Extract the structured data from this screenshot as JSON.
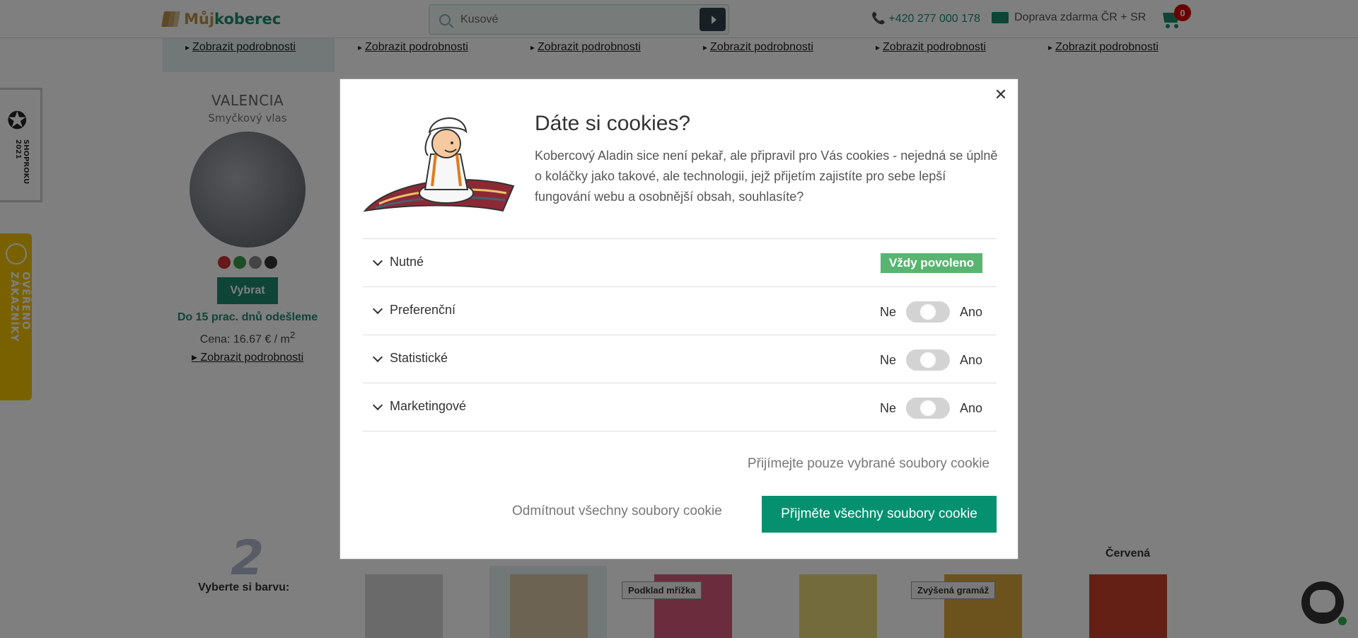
{
  "header": {
    "logo_part1": "Můj",
    "logo_part2": "koberec",
    "search_value": "Kusové",
    "phone": "+420 277 000 178",
    "shipping": "Doprava zdarma ČR + SR",
    "cart_count": "0"
  },
  "background": {
    "detail_links": [
      "Zobrazit podrobnosti",
      "Zobrazit podrobnosti",
      "Zobrazit podrobnosti",
      "Zobrazit podrobnosti",
      "Zobrazit podrobnosti",
      "Zobrazit podrobnosti"
    ],
    "product": {
      "name": "VALENCIA",
      "subtitle": "Smyčkový vlas",
      "color_dots": [
        "#cc3333",
        "#3a9a4a",
        "#888888",
        "#333333"
      ],
      "button": "Vybrat",
      "shipping": "Do 15 prac. dnů odešleme",
      "price": "Cena: 16.67 € / m",
      "price_sup": "2",
      "detail": "Zobrazit podrobnosti"
    },
    "badge_shoproku": "SHOPROKU 2021",
    "badge_overeno": "OVĚŘENO ZÁKAZNÍKY",
    "step_number": "2",
    "step_label": "Vyberte si barvu:",
    "swatch_tags": [
      "Podklad mřížka",
      "Zvýšená gramáž"
    ],
    "color_label": "Červená",
    "swatch_colors": [
      "#d4d4d4",
      "#d9c7a7",
      "#d65b7c",
      "#e8d77a",
      "#d9a73a",
      "#c8402a"
    ]
  },
  "modal": {
    "title": "Dáte si cookies?",
    "text": "Kobercový Aladin sice není pekař, ale připravil pro Vás cookies - nejedná se úplně o koláčky jako takové, ale technologii, jejž přijetím zajistíte pro sebe lepší fungování webu a osobnější obsah, souhlasíte?",
    "categories": [
      {
        "name": "Nutné",
        "always": "Vždy povoleno"
      },
      {
        "name": "Preferenční",
        "off": "Ne",
        "on": "Ano"
      },
      {
        "name": "Statistické",
        "off": "Ne",
        "on": "Ano"
      },
      {
        "name": "Marketingové",
        "off": "Ne",
        "on": "Ano"
      }
    ],
    "accept_selected": "Přijímejte pouze vybrané soubory cookie",
    "reject_all": "Odmítnout všechny soubory cookie",
    "accept_all": "Přijměte všechny soubory cookie"
  }
}
